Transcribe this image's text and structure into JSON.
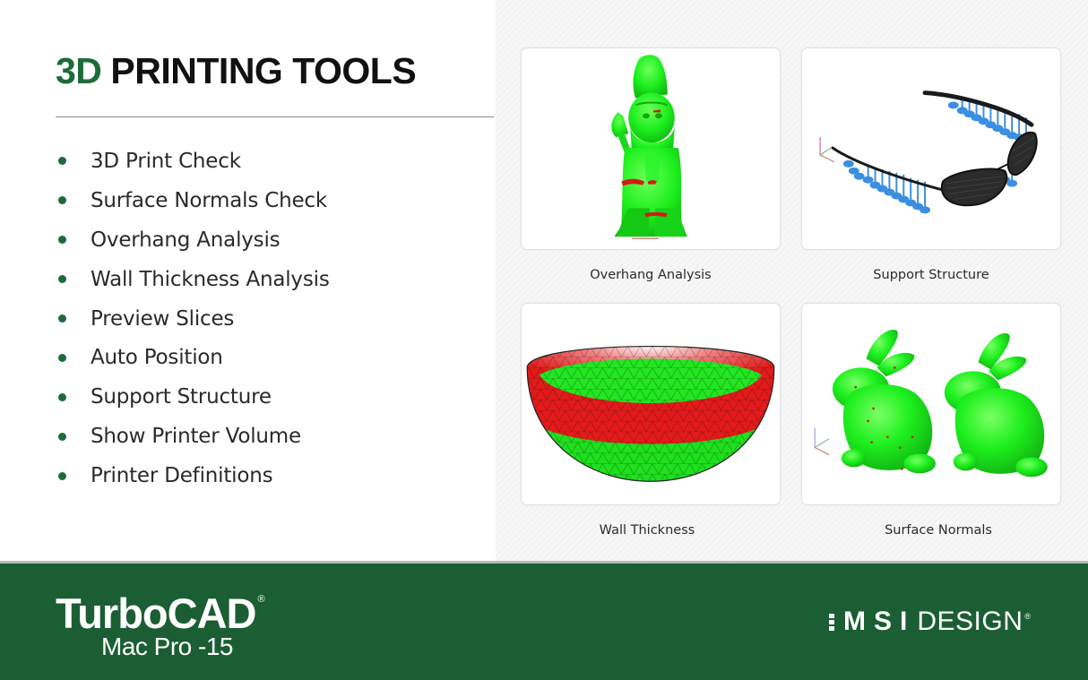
{
  "heading": {
    "accent": "3D",
    "text": "PRINTING TOOLS"
  },
  "features": [
    {
      "label": "3D Print Check"
    },
    {
      "label": "Surface Normals Check"
    },
    {
      "label": "Overhang Analysis"
    },
    {
      "label": "Wall Thickness Analysis"
    },
    {
      "label": "Preview Slices"
    },
    {
      "label": "Auto Position"
    },
    {
      "label": "Support Structure"
    },
    {
      "label": "Show Printer Volume"
    },
    {
      "label": "Printer Definitions"
    }
  ],
  "gallery": [
    {
      "caption": "Overhang Analysis",
      "image": "gnome-model-overhang"
    },
    {
      "caption": "Support Structure",
      "image": "glasses-model-supports"
    },
    {
      "caption": "Wall Thickness",
      "image": "bowl-mesh-wall-thickness"
    },
    {
      "caption": "Surface Normals",
      "image": "bunny-models-normals"
    }
  ],
  "footer": {
    "product": "TurboCAD",
    "registered": "®",
    "edition": "Mac Pro -15",
    "company_msi": "MSI",
    "company_design": "DESIGN",
    "company_registered": "®"
  },
  "colors": {
    "brand_green": "#1b5e33",
    "accent_green": "#1e6b3a",
    "model_green": "#22ee22",
    "model_red": "#e01818",
    "support_blue": "#3b8fe0"
  }
}
